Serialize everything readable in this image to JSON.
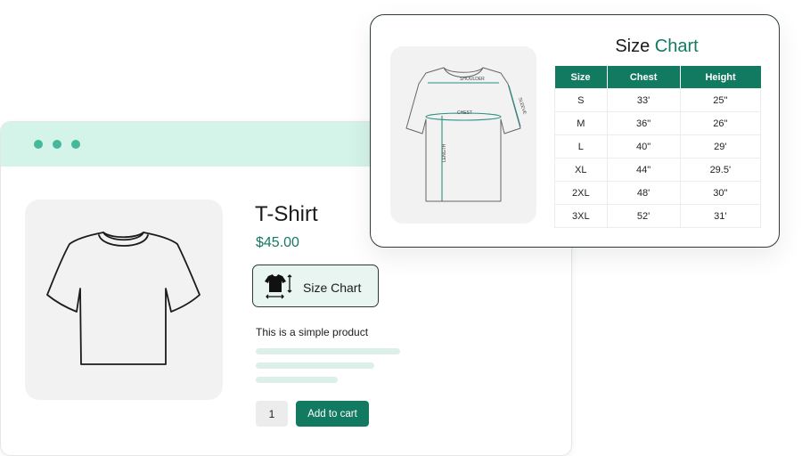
{
  "product": {
    "title": "T-Shirt",
    "price": "$45.00",
    "size_chart_button_label": "Size Chart",
    "description": "This is a simple product",
    "quantity": "1",
    "add_to_cart_label": "Add to cart"
  },
  "size_chart": {
    "title_main": "Size",
    "title_accent": "Chart",
    "diagram_labels": {
      "shoulder": "SHOULDER",
      "chest": "CHEST",
      "length": "LENGTH",
      "sleeve": "SLEEVE"
    },
    "headers": [
      "Size",
      "Chest",
      "Height"
    ],
    "rows": [
      [
        "S",
        "33'",
        "25\""
      ],
      [
        "M",
        "36\"",
        "26\""
      ],
      [
        "L",
        "40\"",
        "29'"
      ],
      [
        "XL",
        "44\"",
        "29.5'"
      ],
      [
        "2XL",
        "48'",
        "30\""
      ],
      [
        "3XL",
        "52'",
        "31'"
      ]
    ]
  },
  "colors": {
    "accent": "#137a62",
    "titlebar": "#d4f3e9",
    "window_dots": "#45b89b",
    "placeholder": "#dcefe9"
  },
  "icons": [
    "tshirt-outline-icon",
    "tshirt-measure-icon",
    "tshirt-diagram-icon"
  ]
}
